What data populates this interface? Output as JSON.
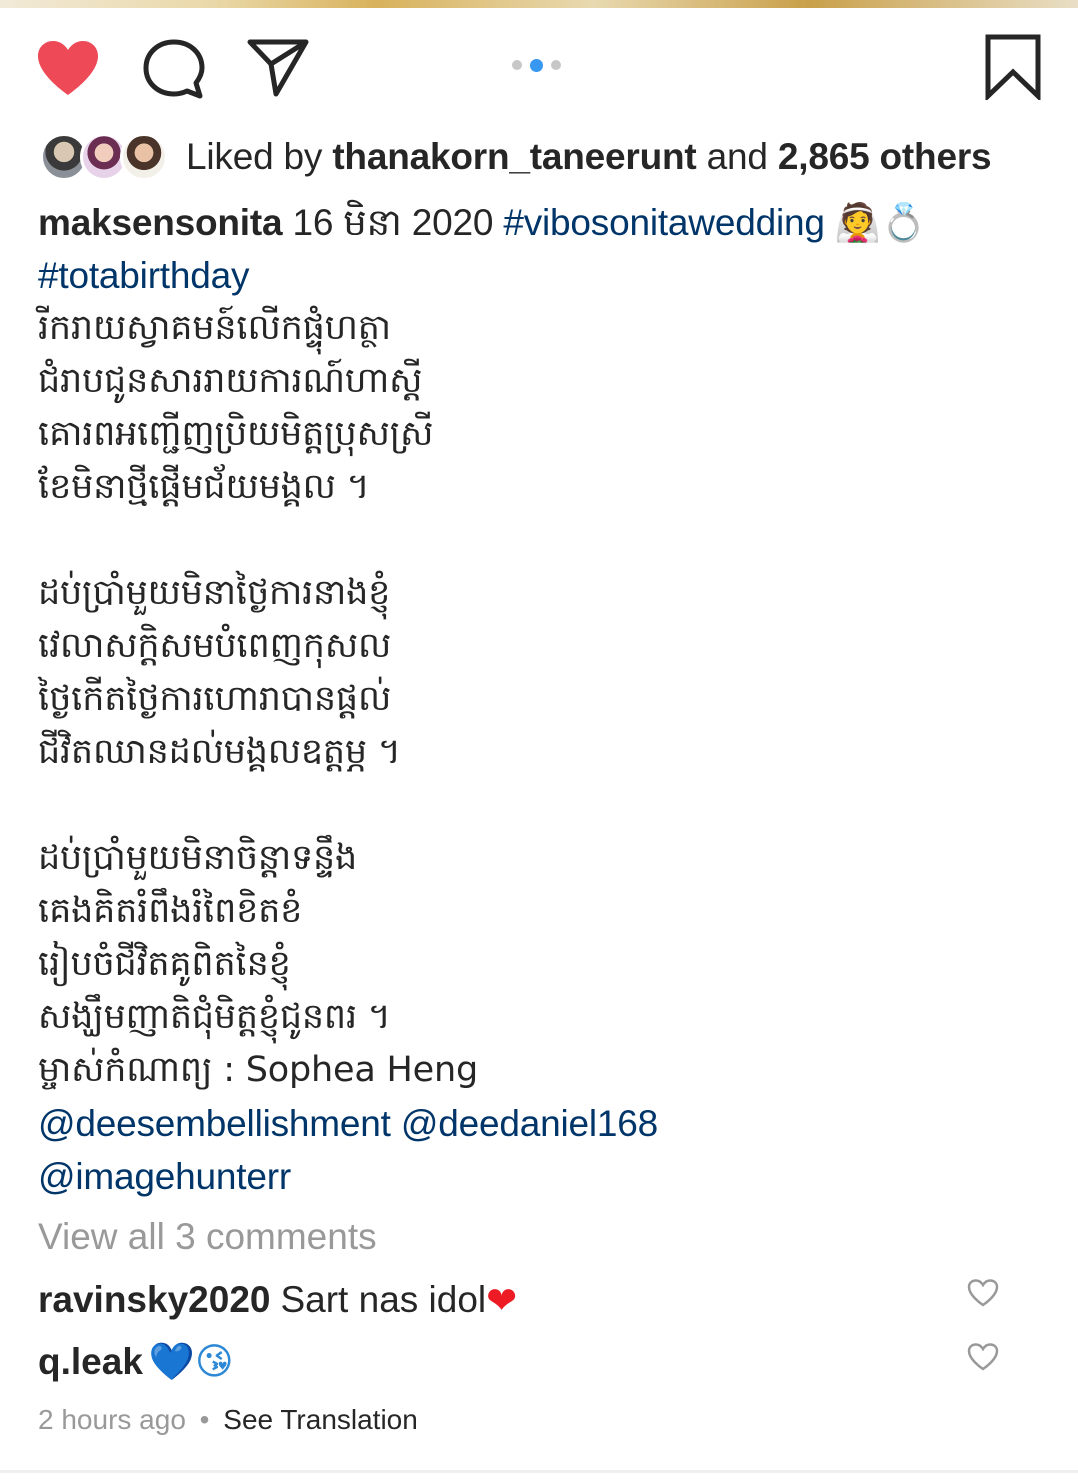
{
  "actions": {
    "icons": [
      "heart-filled-icon",
      "comment-icon",
      "share-icon",
      "bookmark-icon"
    ],
    "like_color": "#ed4956",
    "carousel": {
      "count": 3,
      "active_index": 1,
      "active_color": "#3897f0"
    }
  },
  "likes": {
    "prefix": "Liked by",
    "user": "thanakorn_taneerunt",
    "middle": "and",
    "others": "2,865 others"
  },
  "caption": {
    "author": "maksensonita",
    "date_text": "16 មិនា 2020",
    "hashtag1": "#vibosonitawedding",
    "emojis": "👰💍",
    "hashtag2": "#totabirthday",
    "stanza1": [
      "រីករាយស្វាគមន៍លើកផ្ទុំហត្ថា",
      "ជំរាបជូនសាររាយការណ៍ហាស្តី",
      "គោរពអញ្ជើញប្រិយមិត្តប្រុសស្រី",
      "ខែមិនាថ្មីផ្តើមជ័យមង្គល ។"
    ],
    "stanza2": [
      "ដប់ប្រាំមួយមិនាថ្ងៃការនាងខ្ញុំ",
      "វេលាសក្តិសមបំពេញកុសល",
      "ថ្ងៃកើតថ្ងៃការហោរាបានផ្តល់",
      "ជីវិតឈានដល់មង្គលឧត្តម្ភ ។"
    ],
    "stanza3": [
      "ដប់ប្រាំមួយមិនាចិន្តាទន្ទឹង",
      "គេងគិតរំពឹងរំពៃខិតខំ",
      "រៀបចំជីវិតគូពិតនៃខ្ញុំ",
      "សង្ឃឹមញាតិជុំមិត្តខ្ញុំជូនពរ ។"
    ],
    "credit": "ម្ចាស់កំណាព្យ : Sophea Heng",
    "mention1": "@deesembellishment",
    "mention2": "@deedaniel168",
    "mention3": "@imagehunterr"
  },
  "view_all": "View all 3 comments",
  "comments": [
    {
      "user": "ravinsky2020",
      "text": "Sart nas idol",
      "emoji": "❤"
    },
    {
      "user": "q.leak",
      "text": "",
      "emoji": "💙😘"
    }
  ],
  "meta": {
    "time": "2 hours ago",
    "separator": "•",
    "translate": "See Translation"
  }
}
